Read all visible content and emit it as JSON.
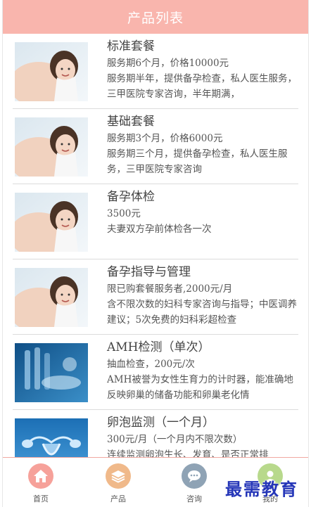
{
  "header": {
    "title": "产品列表"
  },
  "products": [
    {
      "image": "mother-child-photo",
      "title": "标准套餐",
      "price": "服务期6个月，价格10000元",
      "desc": "服务期半年，提供备孕检查，私人医生服务，三甲医院专家咨询，半年期满，"
    },
    {
      "image": "mother-child-photo",
      "title": "基础套餐",
      "price": "服务期3个月，价格6000元",
      "desc": "服务期三个月，提供备孕检查，私人医生服务，三甲医院专家咨询"
    },
    {
      "image": "mother-child-photo",
      "title": "备孕体检",
      "price": "3500元",
      "desc": "夫妻双方孕前体检各一次"
    },
    {
      "image": "mother-child-photo",
      "title": "备孕指导与管理",
      "price": "限已购套餐服务者,2000元/月",
      "desc": "含不限次数的妇科专家咨询与指导；中医调养建议；5次免费的妇科彩超检查"
    },
    {
      "image": "lab-test-photo",
      "title": "AMH检测（单次）",
      "price": "抽血检查，200元/次",
      "desc": "AMH被誉为女性生育力的计时器，能准确地反映卵巢的储备功能和卵巢老化情"
    },
    {
      "image": "uterus-illustration",
      "title": "卵泡监测（一个月）",
      "price": "300元/月（一个月内不限次数）",
      "desc": "连续监测卵泡生长、发育、是否正常排"
    }
  ],
  "tabbar": {
    "home": {
      "label": "首页",
      "icon": "home-icon",
      "color": "#f6a19a"
    },
    "products": {
      "label": "产品",
      "icon": "layers-icon",
      "color": "#f0b98a"
    },
    "consult": {
      "label": "咨询",
      "icon": "chat-icon",
      "color": "#8fa3b5"
    },
    "mine": {
      "label": "我的",
      "icon": "user-icon",
      "color": "#b8d98c"
    }
  },
  "watermark": {
    "text": "最需教育"
  }
}
